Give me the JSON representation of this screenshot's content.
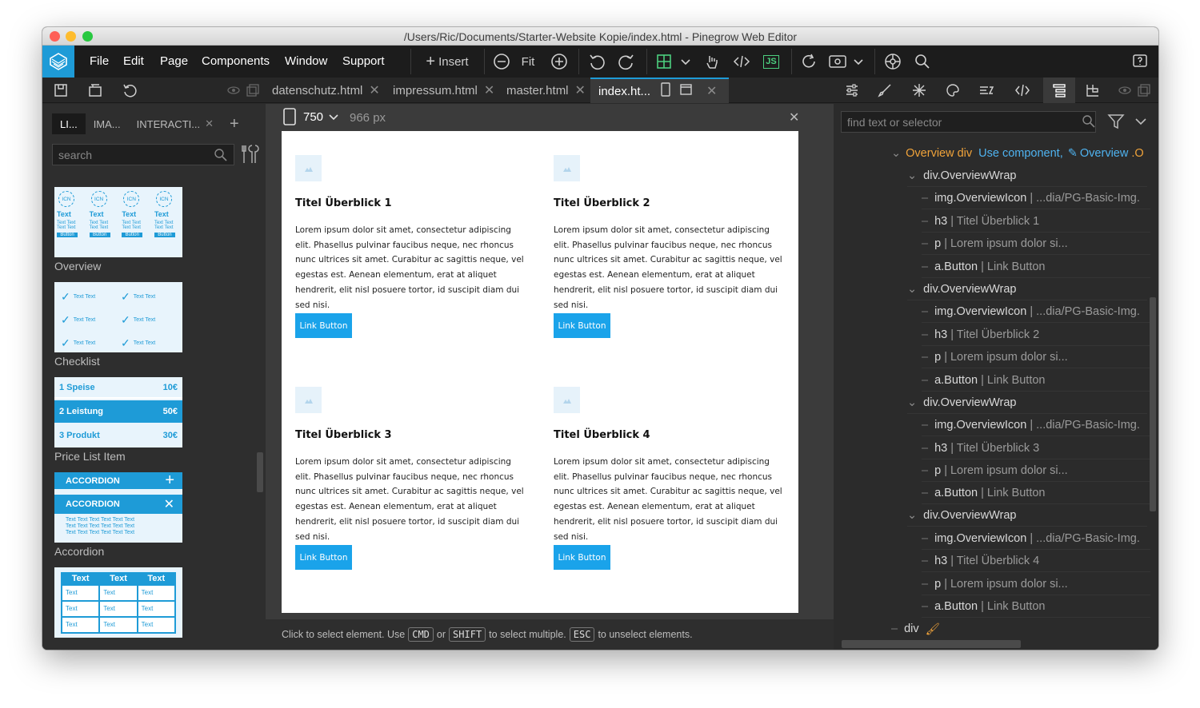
{
  "window": {
    "title": "/Users/Ric/Documents/Starter-Website Kopie/index.html - Pinegrow Web Editor"
  },
  "menu": {
    "file": "File",
    "edit": "Edit",
    "page": "Page",
    "components": "Components",
    "window": "Window",
    "support": "Support"
  },
  "toolbar": {
    "insert": "Insert",
    "fit": "Fit",
    "js": "JS"
  },
  "file_tabs": [
    "datenschutz.html",
    "impressum.html",
    "master.html",
    "index.ht..."
  ],
  "left_panel": {
    "tabs": [
      "LI...",
      "IMA...",
      "INTERACTI..."
    ],
    "search_placeholder": "search",
    "thumb_labels": [
      "Overview",
      "Checklist",
      "Price List Item",
      "Accordion"
    ],
    "overview_thumb": {
      "icn": "ICN",
      "text": "Text",
      "small": "Text Text",
      "button": "Button"
    },
    "checklist_thumb": {
      "item": "Text Text"
    },
    "price_thumb": [
      {
        "name": "1 Speise",
        "price": "10€"
      },
      {
        "name": "2 Leistung",
        "price": "50€"
      },
      {
        "name": "3 Produkt",
        "price": "30€"
      }
    ],
    "accordion_thumb": {
      "label": "ACCORDION",
      "body": "Text Text Text Text Text Text"
    },
    "table_thumb": {
      "head": "Text",
      "cell": "Text"
    }
  },
  "canvas": {
    "width": "750",
    "px_label": "966 px",
    "cards": [
      {
        "title": "Titel Überblick 1",
        "text": "Lorem ipsum dolor sit amet, consectetur adipiscing elit. Phasellus pulvinar faucibus neque, nec rhoncus nunc ultrices sit amet. Curabitur ac sagittis neque, vel egestas est. Aenean elementum, erat at aliquet hendrerit, elit nisl posuere tortor, id suscipit diam dui sed nisi.",
        "button": "Link Button"
      },
      {
        "title": "Titel Überblick 2",
        "text": "Lorem ipsum dolor sit amet, consectetur adipiscing elit. Phasellus pulvinar faucibus neque, nec rhoncus nunc ultrices sit amet. Curabitur ac sagittis neque, vel egestas est. Aenean elementum, erat at aliquet hendrerit, elit nisl posuere tortor, id suscipit diam dui sed nisi.",
        "button": "Link Button"
      },
      {
        "title": "Titel Überblick 3",
        "text": "Lorem ipsum dolor sit amet, consectetur adipiscing elit. Phasellus pulvinar faucibus neque, nec rhoncus nunc ultrices sit amet. Curabitur ac sagittis neque, vel egestas est. Aenean elementum, erat at aliquet hendrerit, elit nisl posuere tortor, id suscipit diam dui sed nisi.",
        "button": "Link Button"
      },
      {
        "title": "Titel Überblick 4",
        "text": "Lorem ipsum dolor sit amet, consectetur adipiscing elit. Phasellus pulvinar faucibus neque, nec rhoncus nunc ultrices sit amet. Curabitur ac sagittis neque, vel egestas est. Aenean elementum, erat at aliquet hendrerit, elit nisl posuere tortor, id suscipit diam dui sed nisi.",
        "button": "Link Button"
      }
    ]
  },
  "status": {
    "part1": "Click to select element. Use",
    "cmd": "CMD",
    "or": "or",
    "shift": "SHIFT",
    "part2": "to select multiple.",
    "esc": "ESC",
    "part3": "to unselect elements."
  },
  "right_panel": {
    "search_placeholder": "find text or selector",
    "root": {
      "name": "Overview div",
      "use_component": "Use component,",
      "component": "Overview",
      "trailing": ".O"
    },
    "groups": [
      {
        "wrap": "div.OverviewWrap",
        "children": [
          {
            "tag": "img.OverviewIcon",
            "detail": "| ...dia/PG-Basic-Img."
          },
          {
            "tag": "h3",
            "detail": "| Titel Überblick 1"
          },
          {
            "tag": "p",
            "detail": "| Lorem ipsum dolor si..."
          },
          {
            "tag": "a.Button",
            "detail": "| Link Button"
          }
        ]
      },
      {
        "wrap": "div.OverviewWrap",
        "children": [
          {
            "tag": "img.OverviewIcon",
            "detail": "| ...dia/PG-Basic-Img."
          },
          {
            "tag": "h3",
            "detail": "| Titel Überblick 2"
          },
          {
            "tag": "p",
            "detail": "| Lorem ipsum dolor si..."
          },
          {
            "tag": "a.Button",
            "detail": "| Link Button"
          }
        ]
      },
      {
        "wrap": "div.OverviewWrap",
        "children": [
          {
            "tag": "img.OverviewIcon",
            "detail": "| ...dia/PG-Basic-Img."
          },
          {
            "tag": "h3",
            "detail": "| Titel Überblick 3"
          },
          {
            "tag": "p",
            "detail": "| Lorem ipsum dolor si..."
          },
          {
            "tag": "a.Button",
            "detail": "| Link Button"
          }
        ]
      },
      {
        "wrap": "div.OverviewWrap",
        "children": [
          {
            "tag": "img.OverviewIcon",
            "detail": "| ...dia/PG-Basic-Img."
          },
          {
            "tag": "h3",
            "detail": "| Titel Überblick 4"
          },
          {
            "tag": "p",
            "detail": "| Lorem ipsum dolor si..."
          },
          {
            "tag": "a.Button",
            "detail": "| Link Button"
          }
        ]
      }
    ],
    "last": "div"
  },
  "colors": {
    "accent": "#1e9bd7",
    "button": "#1aa3ea",
    "component": "#f0a33a",
    "link": "#4fb3f0",
    "js": "#4ccf7f"
  }
}
